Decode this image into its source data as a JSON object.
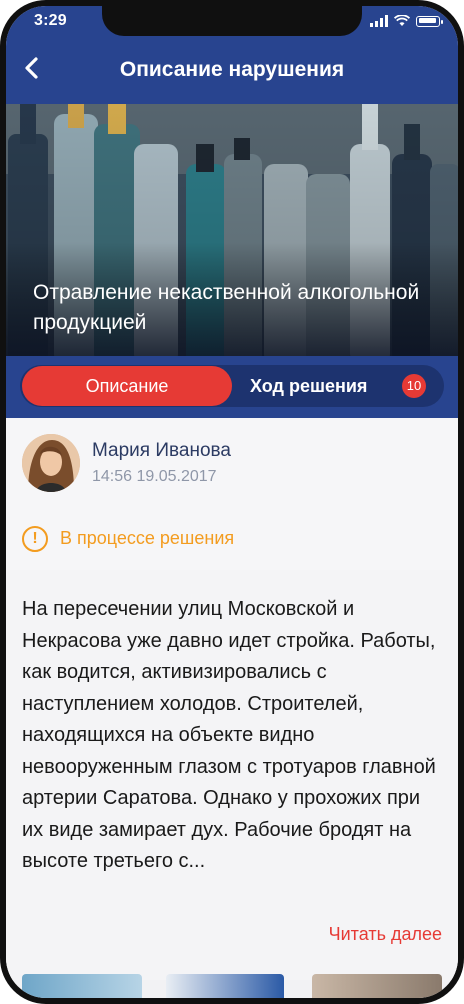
{
  "status_bar": {
    "time": "3:29"
  },
  "header": {
    "title": "Описание нарушения",
    "back_icon": "chevron-left-icon"
  },
  "hero": {
    "caption": "Отравление некаственной алкогольной продукцией"
  },
  "tabs": {
    "active_label": "Описание",
    "progress_label": "Ход решения",
    "progress_count": "10"
  },
  "author": {
    "name": "Мария Иванова",
    "datetime": "14:56 19.05.2017"
  },
  "status": {
    "text": "В процессе решения",
    "icon": "alert-circle-icon",
    "color": "#f39c1f"
  },
  "description": {
    "text": "На пересечении улиц Московской и Некрасова уже давно идет стройка. Работы, как водится, активизировались с наступлением холодов. Строителей, находящихся на объекте видно невооруженным глазом с тротуаров главной артерии Саратова. Однако у прохожих при их виде замирает дух. Рабочие бродят на высоте третьего с...",
    "read_more": "Читать далее"
  },
  "colors": {
    "brand": "#28448f",
    "accent": "#e63a35"
  }
}
